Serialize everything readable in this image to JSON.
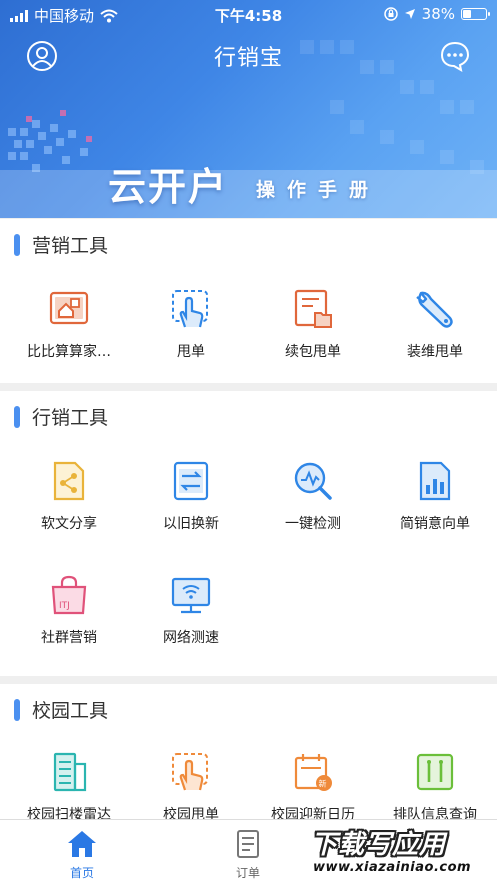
{
  "status_bar": {
    "carrier": "中国移动",
    "time": "下午4:58",
    "battery": "38%",
    "battery_level": 0.38
  },
  "nav": {
    "title": "行销宝"
  },
  "banner": {
    "title": "云开户",
    "subtitle": "操作手册"
  },
  "sections": {
    "marketing": {
      "title": "营销工具",
      "items": [
        {
          "label": "比比算算家…",
          "icon": "house-calc-icon",
          "color": "#e0673b"
        },
        {
          "label": "甩单",
          "icon": "hand-tap-icon",
          "color": "#2f86e6"
        },
        {
          "label": "续包甩单",
          "icon": "document-folder-icon",
          "color": "#e0673b"
        },
        {
          "label": "装维甩单",
          "icon": "wrench-icon",
          "color": "#2f86e6"
        }
      ]
    },
    "sales": {
      "title": "行销工具",
      "items": [
        {
          "label": "软文分享",
          "icon": "share-doc-icon",
          "color": "#e9b33a"
        },
        {
          "label": "以旧换新",
          "icon": "exchange-icon",
          "color": "#2f86e6"
        },
        {
          "label": "一键检测",
          "icon": "magnifier-pulse-icon",
          "color": "#2f86e6"
        },
        {
          "label": "简销意向单",
          "icon": "chart-doc-icon",
          "color": "#2f86e6"
        },
        {
          "label": "社群营销",
          "icon": "shopping-bag-icon",
          "color": "#e0527a"
        },
        {
          "label": "网络测速",
          "icon": "monitor-wifi-icon",
          "color": "#2f86e6"
        }
      ]
    },
    "campus": {
      "title": "校园工具",
      "items": [
        {
          "label": "校园扫楼雷达",
          "icon": "building-icon",
          "color": "#2bb5b0"
        },
        {
          "label": "校园甩单",
          "icon": "hand-tap-icon",
          "color": "#ef8a3a"
        },
        {
          "label": "校园迎新日历",
          "icon": "calendar-new-icon",
          "color": "#ef8a3a"
        },
        {
          "label": "排队信息查询",
          "icon": "queue-icon",
          "color": "#6bbf3a"
        }
      ]
    }
  },
  "tabbar": {
    "home": "首页",
    "orders": "订单"
  },
  "watermark": {
    "line1": "下载写应用",
    "line2": "www.xiazainiao.com"
  }
}
